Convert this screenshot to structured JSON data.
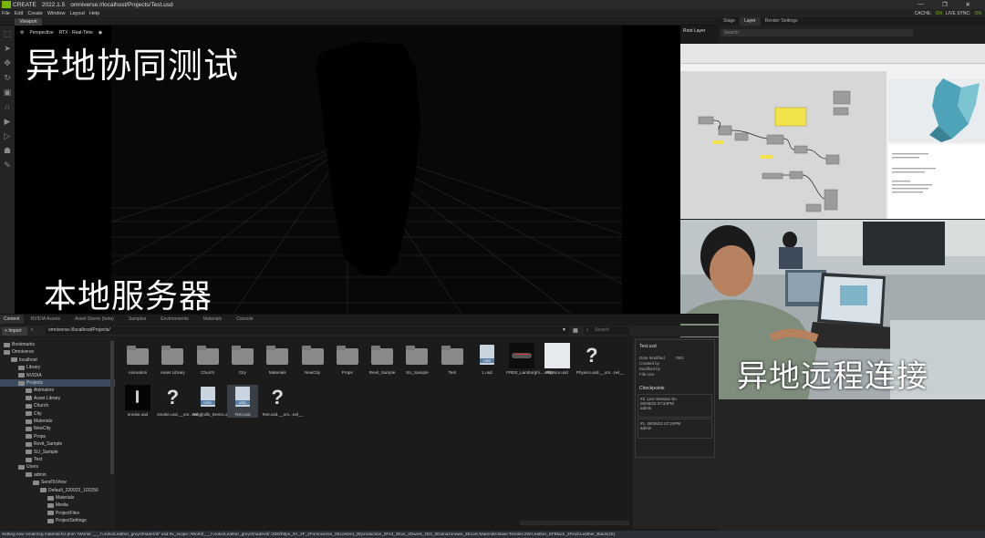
{
  "app": {
    "title": "CREATE",
    "version": "2022.1.5",
    "file_path": "omniverse://localhost/Projects/Test.usd"
  },
  "menu": [
    "File",
    "Edit",
    "Create",
    "Window",
    "Layout",
    "Help"
  ],
  "status_flags": {
    "cache_label": "CACHE:",
    "cache_value": "ON",
    "live_sync_label": "LIVE SYNC:",
    "live_sync_value": "ON"
  },
  "viewport": {
    "tab_label": "Viewport",
    "camera": "Perspective",
    "renderer": "RTX - Real-Time"
  },
  "overlays": {
    "top_left": "异地协同测试",
    "bottom_left": "本地服务器",
    "right": "异地远程连接"
  },
  "right_panel": {
    "tabs": [
      "Stage",
      "Layer",
      "Render Settings"
    ],
    "active_tab": "Layer",
    "search_placeholder": "Search",
    "root_layer": "Root Layer"
  },
  "content_browser": {
    "tabs": [
      "Content",
      "NVIDIA Assets",
      "Asset Stores (beta)",
      "Samples",
      "Environments",
      "Materials",
      "Console"
    ],
    "import_label": "Import",
    "path": "omniverse://localhost/Projects/",
    "search_placeholder": "Search",
    "tree": [
      {
        "label": "Bookmarks",
        "depth": 0
      },
      {
        "label": "Omniverse",
        "depth": 0
      },
      {
        "label": "localhost",
        "depth": 1
      },
      {
        "label": "Library",
        "depth": 2
      },
      {
        "label": "NVIDIA",
        "depth": 2
      },
      {
        "label": "Projects",
        "depth": 2,
        "selected": true
      },
      {
        "label": "Animation",
        "depth": 3
      },
      {
        "label": "Asset Library",
        "depth": 3
      },
      {
        "label": "Church",
        "depth": 3
      },
      {
        "label": "City",
        "depth": 3
      },
      {
        "label": "Materials",
        "depth": 3
      },
      {
        "label": "NewCity",
        "depth": 3
      },
      {
        "label": "Props",
        "depth": 3
      },
      {
        "label": "Revit_Sample",
        "depth": 3
      },
      {
        "label": "SU_Sample",
        "depth": 3
      },
      {
        "label": "Test",
        "depth": 3
      },
      {
        "label": "Users",
        "depth": 2
      },
      {
        "label": "admin",
        "depth": 3
      },
      {
        "label": "SendToView",
        "depth": 4
      },
      {
        "label": "Default_220922_102256",
        "depth": 5
      },
      {
        "label": "Materials",
        "depth": 6
      },
      {
        "label": "Media",
        "depth": 6
      },
      {
        "label": "ProjectFiles",
        "depth": 6
      },
      {
        "label": "ProjectSettings",
        "depth": 6
      }
    ],
    "assets_row1": [
      {
        "label": "Animation",
        "type": "folder"
      },
      {
        "label": "Asset Library",
        "type": "folder"
      },
      {
        "label": "Church",
        "type": "folder"
      },
      {
        "label": "City",
        "type": "folder"
      },
      {
        "label": "Materials",
        "type": "folder"
      },
      {
        "label": "NewCity",
        "type": "folder"
      },
      {
        "label": "Props",
        "type": "folder"
      },
      {
        "label": "Revit_Sample",
        "type": "folder"
      },
      {
        "label": "SU_Sample",
        "type": "folder"
      },
      {
        "label": "Test",
        "type": "folder"
      },
      {
        "label": "1.usd",
        "type": "usd"
      },
      {
        "label": "FREE_Lamborghi....usdz",
        "type": "car"
      },
      {
        "label": "Physics.usd",
        "type": "white"
      },
      {
        "label": "Physics.usd.__om...nel__",
        "type": "unknown"
      }
    ],
    "assets_row2": [
      {
        "label": "smoke.usd",
        "type": "smoke"
      },
      {
        "label": "smoke.usd.__om...nel__",
        "type": "unknown"
      },
      {
        "label": "Windmills_Demo.usd",
        "type": "usd"
      },
      {
        "label": "Test.usd",
        "type": "usd",
        "selected": true
      },
      {
        "label": "Test.usd.__om...nel__",
        "type": "unknown"
      }
    ],
    "details": {
      "file": "Test.usd",
      "date_modified_label": "Date Modified",
      "date_modified_value": "09/2",
      "created_by_label": "Created by",
      "modified_by_label": "Modified by",
      "file_size_label": "File size",
      "checkpoints_label": "Checkpoints",
      "checkpoints": [
        {
          "id": "#2.",
          "title": "Live Session Sn",
          "date": "09/26/22 07:24PM",
          "user": "admin"
        },
        {
          "id": "#1.",
          "title": "",
          "date": "09/26/22 07:24PM",
          "user": "admin"
        }
      ]
    }
  },
  "status_bar": "Setting new rendering material for prim '/World/ ___ h.soko/Leather_grey/Shader/d/' usd:rtx_scope::/World/___h.soko/Leather_grey/Shader/d/::2D0/https_3A_2F_2Fomniverse_2Econtent_2Eproduction_2Fs3_2Eus_2Dwest_2D2_2Eamazonaws_2Ecom:Materials:Base:Textiles:2W:Leather_SFBlack_2Findi:Leather_Black(15)"
}
